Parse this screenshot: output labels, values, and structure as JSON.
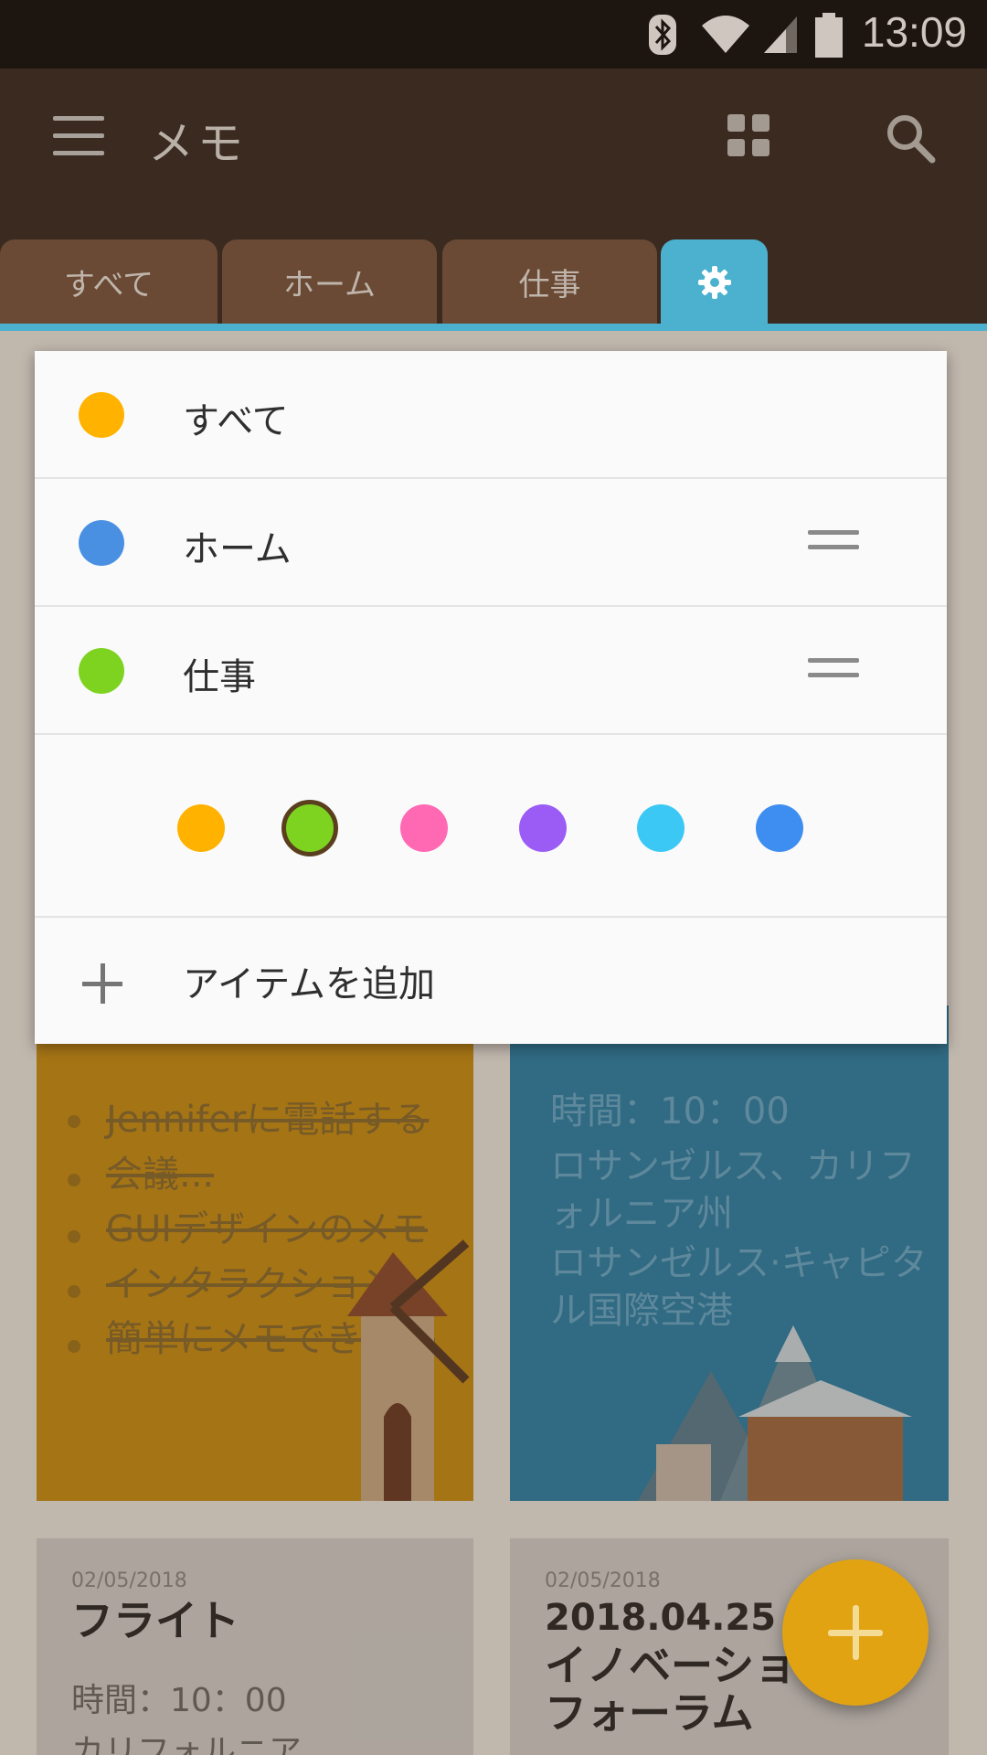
{
  "status_bar": {
    "time": "13:09"
  },
  "app_bar": {
    "title": "メモ"
  },
  "tabs": [
    {
      "label": "すべて"
    },
    {
      "label": "ホーム"
    },
    {
      "label": "仕事"
    }
  ],
  "category_list": [
    {
      "label": "すべて",
      "color": "#FFB300"
    },
    {
      "label": "ホーム",
      "color": "#4A90E2"
    },
    {
      "label": "仕事",
      "color": "#7ED321"
    }
  ],
  "color_palette": [
    "#FFB300",
    "#7ED321",
    "#FF69B4",
    "#9B5CF6",
    "#3BC8F5",
    "#3D8EF0"
  ],
  "selected_color": "#7ED321",
  "add_item": {
    "label": "アイテムを追加"
  },
  "notes": {
    "orange": {
      "items": [
        "Jenniferに電話する",
        "会議...",
        "GUIデザインのメモ",
        "インタラクション",
        "簡単にメモできます"
      ]
    },
    "blue": {
      "time": "時間：10：00",
      "location": "ロサンゼルス、カリフォルニア州",
      "airport": "ロサンゼルス·キャピタル国際空港"
    },
    "bottom_left": {
      "date": "02/05/2018",
      "title": "フライト",
      "body1": "時間：10：00",
      "body2": "カリフォルニア"
    },
    "bottom_right": {
      "date": "02/05/2018",
      "title1": "2018.04.25",
      "title2": "イノベーショ",
      "title3": "フォーラム"
    }
  }
}
